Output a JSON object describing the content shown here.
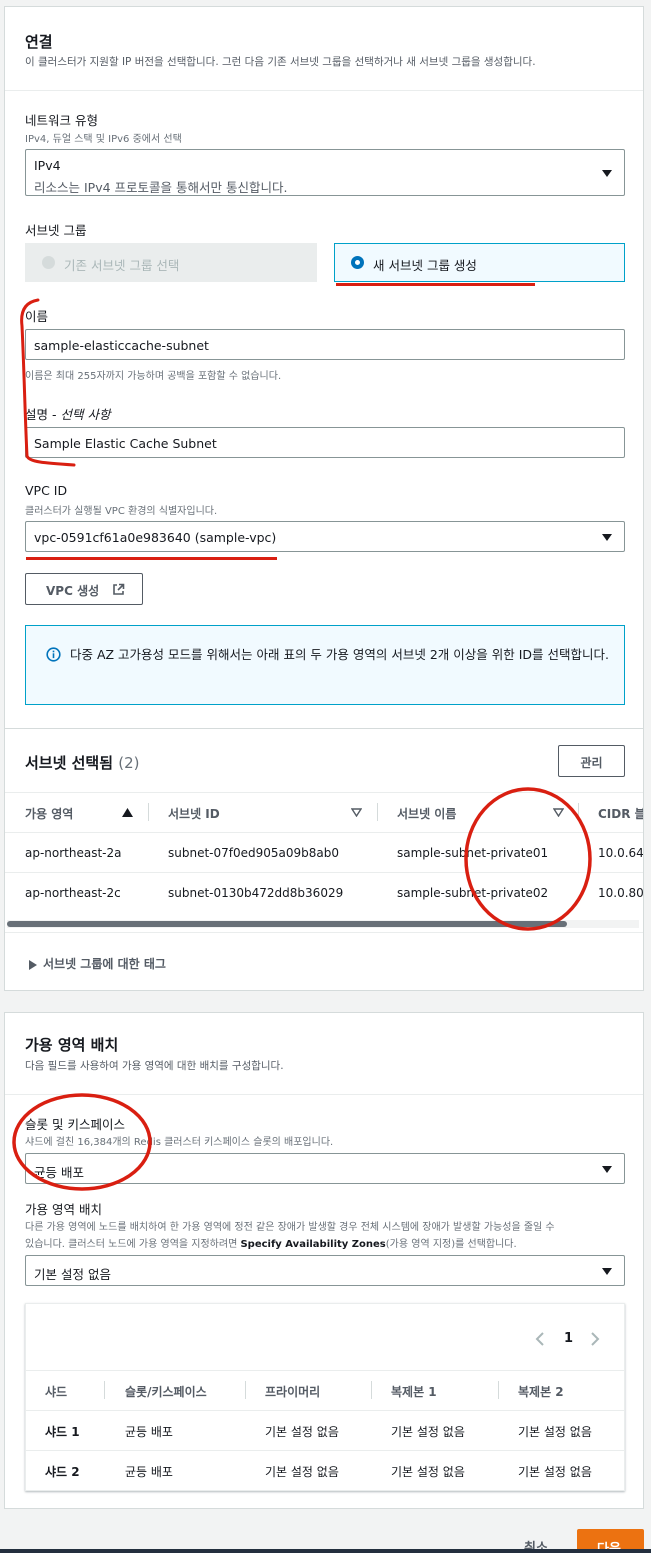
{
  "connection": {
    "title": "연결",
    "description": "이 클러스터가 지원할 IP 버전을 선택합니다. 그런 다음 기존 서브넷 그룹을 선택하거나 새 서브넷 그룹을 생성합니다.",
    "network_type": {
      "label": "네트워크 유형",
      "hint": "IPv4, 듀얼 스택 및 IPv6 중에서 선택",
      "value": "IPv4",
      "value_desc": "리소스는 IPv4 프로토콜을 통해서만 통신합니다."
    },
    "subnet_group": {
      "label": "서브넷 그룹",
      "option_existing": "기존 서브넷 그룹 선택",
      "option_new": "새 서브넷 그룹 생성"
    },
    "name": {
      "label": "이름",
      "value": "sample-elasticcache-subnet",
      "hint": "이름은 최대 255자까지 가능하며 공백을 포함할 수 없습니다."
    },
    "description_field": {
      "label": "설명 - ",
      "label_optional": "선택 사항",
      "value": "Sample Elastic Cache Subnet"
    },
    "vpc": {
      "label": "VPC ID",
      "hint": "클러스터가 실행될 VPC 환경의 식별자입니다.",
      "value": "vpc-0591cf61a0e983640 (sample-vpc)",
      "create_button": "VPC 생성"
    },
    "info_alert": "다중 AZ 고가용성 모드를 위해서는 아래 표의 두 가용 영역의 서브넷 2개 이상을 위한 ID를 선택합니다."
  },
  "subnets": {
    "title": "서브넷 선택됨",
    "count": "(2)",
    "manage_button": "관리",
    "columns": [
      "가용 영역",
      "서브넷 ID",
      "서브넷 이름",
      "CIDR 블"
    ],
    "rows": [
      [
        "ap-northeast-2a",
        "subnet-07f0ed905a09b8ab0",
        "sample-subnet-private01",
        "10.0.64"
      ],
      [
        "ap-northeast-2c",
        "subnet-0130b472dd8b36029",
        "sample-subnet-private02",
        "10.0.80"
      ]
    ],
    "tags_toggle": "서브넷 그룹에 대한 태그"
  },
  "placement": {
    "title": "가용 영역 배치",
    "description": "다음 필드를 사용하여 가용 영역에 대한 배치를 구성합니다.",
    "slots": {
      "label": "슬롯 및 키스페이스",
      "hint": "샤드에 걸친 16,384개의 Redis 클러스터 키스페이스 슬롯의 배포입니다.",
      "value": "균등 배포"
    },
    "az": {
      "label": "가용 영역 배치",
      "hint_line1": "다른 가용 영역에 노드를 배치하여 한 가용 영역에 정전 같은 장애가 발생할 경우 전체 시스템에 장애가 발생할 가능성을 줄일 수",
      "hint_line2_a": "있습니다. 클러스터 노드에 가용 영역을 지정하려면 ",
      "hint_line2_b": "Specify Availability Zones",
      "hint_line2_c": "(가용 영역 지정)를 선택합니다.",
      "value": "기본 설정 없음"
    },
    "pagination": {
      "page": "1"
    },
    "columns": [
      "샤드",
      "슬롯/키스페이스",
      "프라이머리",
      "복제본 1",
      "복제본 2"
    ],
    "rows": [
      [
        "샤드 1",
        "균등 배포",
        "기본 설정 없음",
        "기본 설정 없음",
        "기본 설정 없음"
      ],
      [
        "샤드 2",
        "균등 배포",
        "기본 설정 없음",
        "기본 설정 없음",
        "기본 설정 없음"
      ]
    ]
  },
  "footer": {
    "cancel": "취소",
    "next": "다음"
  },
  "colors": {
    "accent": "#0073bb",
    "annotation_red": "#d91f11",
    "primary_button": "#ec7211"
  }
}
